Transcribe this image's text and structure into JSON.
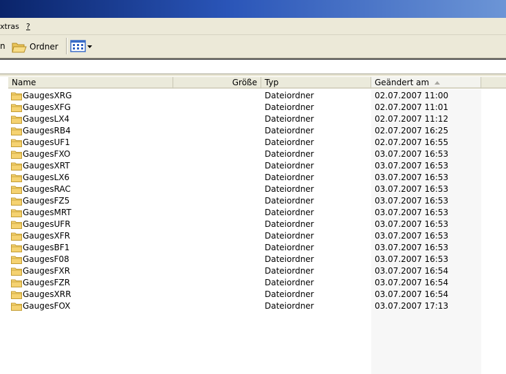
{
  "menu": {
    "extras": "xtras",
    "help": "?"
  },
  "toolbar": {
    "left_text": "n",
    "folders_label": "Ordner"
  },
  "icons": {
    "folder": "folder-icon",
    "view": "view-menu-icon"
  },
  "colors": {
    "folder_fill": "#f5d271",
    "folder_stroke": "#c29a2f",
    "sorted_column_bg": "#f7f7f7"
  },
  "columns": {
    "name": "Name",
    "size": "Größe",
    "type": "Typ",
    "modified": "Geändert am"
  },
  "sort": {
    "column": "modified",
    "direction": "ascending"
  },
  "files": [
    {
      "name": "GaugesXRG",
      "type": "Dateiordner",
      "modified": "02.07.2007 11:00"
    },
    {
      "name": "GaugesXFG",
      "type": "Dateiordner",
      "modified": "02.07.2007 11:01"
    },
    {
      "name": "GaugesLX4",
      "type": "Dateiordner",
      "modified": "02.07.2007 11:12"
    },
    {
      "name": "GaugesRB4",
      "type": "Dateiordner",
      "modified": "02.07.2007 16:25"
    },
    {
      "name": "GaugesUF1",
      "type": "Dateiordner",
      "modified": "02.07.2007 16:55"
    },
    {
      "name": "GaugesFXO",
      "type": "Dateiordner",
      "modified": "03.07.2007 16:53"
    },
    {
      "name": "GaugesXRT",
      "type": "Dateiordner",
      "modified": "03.07.2007 16:53"
    },
    {
      "name": "GaugesLX6",
      "type": "Dateiordner",
      "modified": "03.07.2007 16:53"
    },
    {
      "name": "GaugesRAC",
      "type": "Dateiordner",
      "modified": "03.07.2007 16:53"
    },
    {
      "name": "GaugesFZ5",
      "type": "Dateiordner",
      "modified": "03.07.2007 16:53"
    },
    {
      "name": "GaugesMRT",
      "type": "Dateiordner",
      "modified": "03.07.2007 16:53"
    },
    {
      "name": "GaugesUFR",
      "type": "Dateiordner",
      "modified": "03.07.2007 16:53"
    },
    {
      "name": "GaugesXFR",
      "type": "Dateiordner",
      "modified": "03.07.2007 16:53"
    },
    {
      "name": "GaugesBF1",
      "type": "Dateiordner",
      "modified": "03.07.2007 16:53"
    },
    {
      "name": "GaugesF08",
      "type": "Dateiordner",
      "modified": "03.07.2007 16:53"
    },
    {
      "name": "GaugesFXR",
      "type": "Dateiordner",
      "modified": "03.07.2007 16:54"
    },
    {
      "name": "GaugesFZR",
      "type": "Dateiordner",
      "modified": "03.07.2007 16:54"
    },
    {
      "name": "GaugesXRR",
      "type": "Dateiordner",
      "modified": "03.07.2007 16:54"
    },
    {
      "name": "GaugesFOX",
      "type": "Dateiordner",
      "modified": "03.07.2007 17:13"
    }
  ]
}
